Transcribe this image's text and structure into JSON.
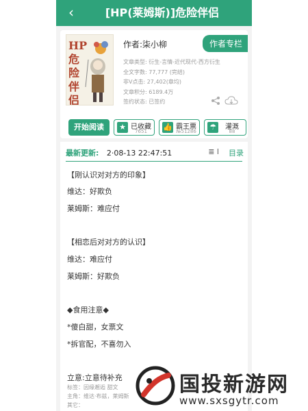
{
  "header": {
    "back_icon": "back-chevron-icon",
    "title": "[HP(莱姆斯)]危险伴侣"
  },
  "book": {
    "cover_title": "HP危险伴侣",
    "author": "作者:柒小柳",
    "author_column": "作者专栏",
    "meta": [
      "文章类型: 衍生-言情-近代现代-西方衍生",
      "全文字数: 77,777 (完结)",
      "非V点击: 27,402(章均)",
      "文章积分: 6189.4万",
      "签约状态: 已签约"
    ],
    "share_icon": "share-icon",
    "download_icon": "cloud-download-icon"
  },
  "actions": {
    "read": "开始阅读",
    "collect": {
      "label": "已收藏",
      "count": "7651",
      "icon": "star-icon"
    },
    "king": {
      "label": "霸王票",
      "count": "№51286",
      "icon": "thumbs-up-icon"
    },
    "water": {
      "label": "灌溉",
      "count": "88",
      "icon": "watering-icon"
    }
  },
  "content": {
    "update_label": "最新更新:",
    "update_time": "2·08-13 22:47:51",
    "toc_icon_text": "≣ l",
    "toc_label": "目录",
    "lines": [
      "【刚认识对对方的印象】",
      "维达：好欺负",
      "莱姆斯：难应付",
      "【相恋后对对方的认识】",
      "维达：难应付",
      "莱姆斯：好欺负",
      "◆食用注意◆",
      "*傻白甜，女票文",
      "*拆官配，不喜勿入"
    ],
    "concept": "立意:立意待补充",
    "tags": [
      "标签：因缘邂逅 甜文",
      "主角：维达·布兹，莱姆斯",
      "其它："
    ]
  },
  "watermark": {
    "name": "国投新游网",
    "url": "www.sxsgytr.com"
  },
  "colors": {
    "accent": "#2fa37b",
    "meta_text": "#9a9a9a"
  }
}
